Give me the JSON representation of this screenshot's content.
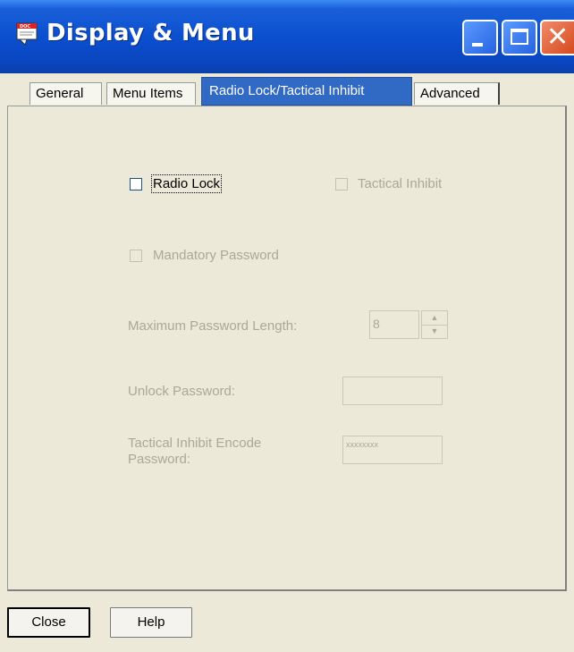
{
  "window": {
    "title": "Display & Menu",
    "icon": "doc-app-icon",
    "accent": "#0b4fcf"
  },
  "tabs": [
    {
      "label": "General",
      "selected": false
    },
    {
      "label": "Menu Items",
      "selected": false
    },
    {
      "label": "Radio Lock/Tactical Inhibit",
      "selected": true
    },
    {
      "label": "Advanced",
      "selected": false
    }
  ],
  "panel": {
    "radio_lock": {
      "label": "Radio Lock",
      "checked": false,
      "enabled": true
    },
    "tactical_inhibit": {
      "label": "Tactical Inhibit",
      "checked": false,
      "enabled": false
    },
    "mandatory_password": {
      "label": "Mandatory Password",
      "checked": false,
      "enabled": false
    },
    "max_password_length": {
      "label": "Maximum Password Length:",
      "value": "8"
    },
    "unlock_password": {
      "label": "Unlock Password:",
      "value": ""
    },
    "tactical_encode_password": {
      "label_line1": "Tactical Inhibit Encode",
      "label_line2": "Password:",
      "value": "xxxxxxxx"
    }
  },
  "buttons": {
    "close": "Close",
    "help": "Help"
  }
}
